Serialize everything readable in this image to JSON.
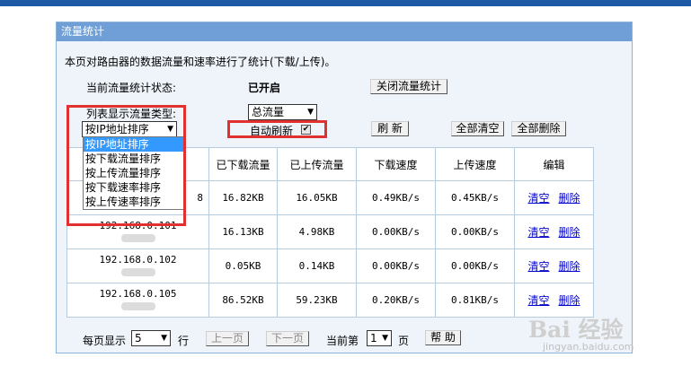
{
  "panel": {
    "title": "流量统计"
  },
  "intro": "本页对路由器的数据流量和速率进行了统计(下载/上传)。",
  "status": {
    "label": "当前流量统计状态:",
    "value": "已开启",
    "toggle_button": "关闭流量统计"
  },
  "list_type": {
    "label": "列表显示流量类型:",
    "value": "总流量"
  },
  "sort": {
    "value": "按IP地址排序",
    "options": [
      "按IP地址排序",
      "按下载流量排序",
      "按上传流量排序",
      "按下载速率排序",
      "按上传速率排序"
    ]
  },
  "auto_refresh": {
    "label": "自动刷新"
  },
  "buttons": {
    "refresh": "刷 新",
    "clear_all": "全部清空",
    "delete_all": "全部删除"
  },
  "table": {
    "headers": [
      "已下载流量",
      "已上传流量",
      "下载速度",
      "上传速度",
      "编辑"
    ],
    "rows": [
      {
        "ip": "",
        "download": "16.82KB",
        "upload": "16.05KB",
        "down_speed": "0.49KB/s",
        "up_speed": "0.45KB/s"
      },
      {
        "ip": "192.168.0.101",
        "download": "16.13KB",
        "upload": "4.98KB",
        "down_speed": "0.00KB/s",
        "up_speed": "0.00KB/s"
      },
      {
        "ip": "192.168.0.102",
        "download": "0.05KB",
        "upload": "0.14KB",
        "down_speed": "0.00KB/s",
        "up_speed": "0.00KB/s"
      },
      {
        "ip": "192.168.0.105",
        "download": "86.52KB",
        "upload": "59.23KB",
        "down_speed": "0.20KB/s",
        "up_speed": "0.81KB/s"
      }
    ],
    "clear_link": "清空",
    "delete_link": "删除",
    "row0_ip_fragment": "8"
  },
  "pager": {
    "per_page_label": "每页显示",
    "per_page_value": "5",
    "rows_unit": "行",
    "prev": "上一页",
    "next": "下一页",
    "current_label": "当前第",
    "current_value": "1",
    "page_unit": "页",
    "help": "帮 助"
  },
  "watermark": {
    "text": "Bai 经验",
    "sub": "jingyan.baidu.com"
  },
  "colors": {
    "header_bar": "#6f9fd6",
    "highlight": "#e03030",
    "selected_option": "#3399ff"
  }
}
